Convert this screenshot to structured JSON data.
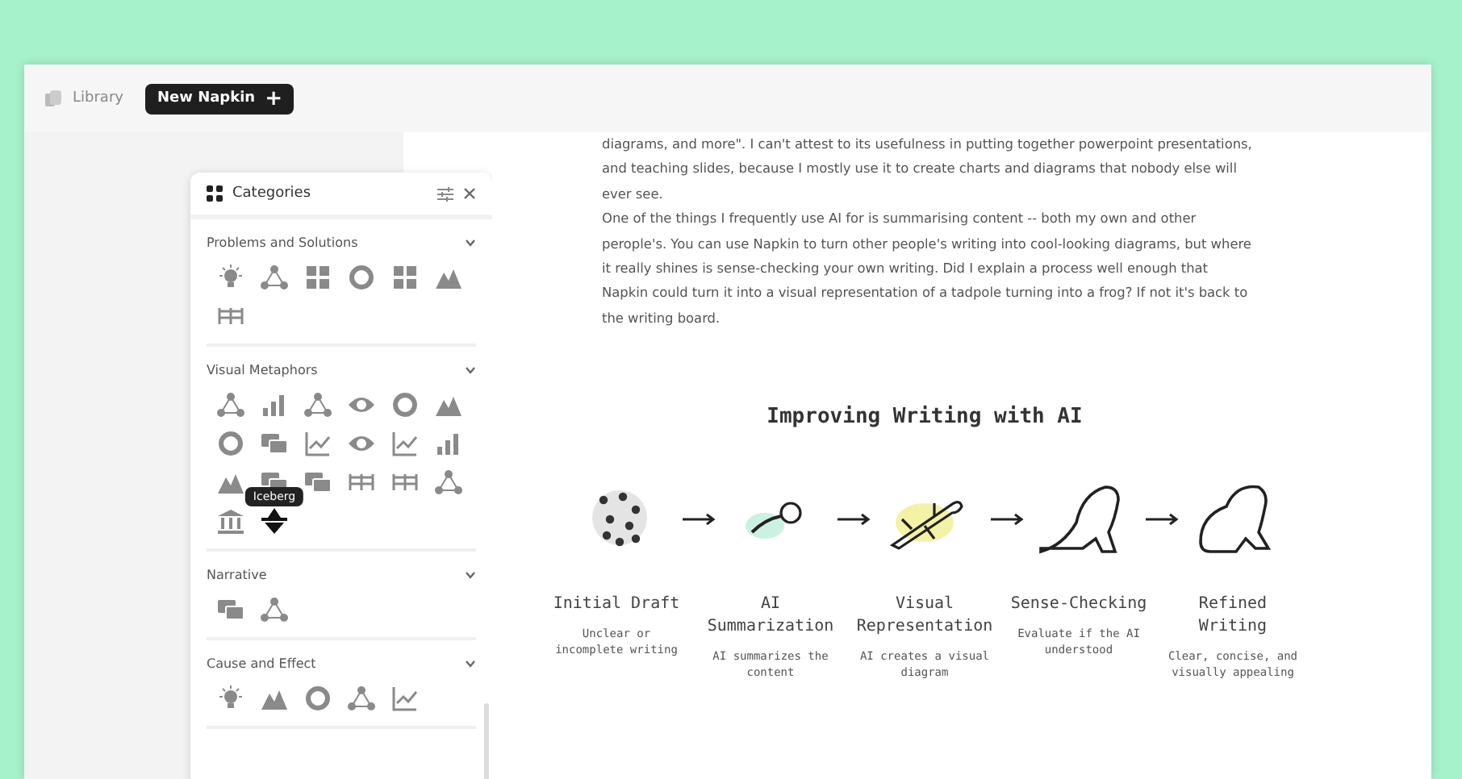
{
  "header": {
    "library": "Library",
    "new_button": "New Napkin",
    "new_button_icon": "+"
  },
  "categories_panel": {
    "title": "Categories",
    "sections": [
      {
        "name": "Problems and Solutions",
        "expanded": true
      },
      {
        "name": "Visual Metaphors",
        "expanded": true,
        "tooltip": "Iceberg"
      },
      {
        "name": "Narrative",
        "expanded": true
      },
      {
        "name": "Cause and Effect",
        "expanded": true
      }
    ]
  },
  "article": {
    "paragraphs": [
      "diagrams, and more\". I can't attest to its usefulness in putting together powerpoint presentations, and teaching slides, because I mostly use it to create charts and diagrams that nobody else will ever see.",
      "One of the things I frequently use AI for is summarising content -- both my own and other perople's. You can use Napkin to turn other people's writing into cool-looking diagrams, but where it really shines is sense-checking your own writing. Did I explain a process well enough that Napkin could turn it into a visual representation of a tadpole turning into a frog? If not it's back to the writing board."
    ]
  },
  "diagram": {
    "title": "Improving Writing with AI",
    "steps": [
      {
        "title": "Initial Draft",
        "caption": "Unclear or incomplete writing"
      },
      {
        "title": "AI Summarization",
        "caption": "AI summarizes the content"
      },
      {
        "title": "Visual Representation",
        "caption": "AI creates a visual diagram"
      },
      {
        "title": "Sense-Checking",
        "caption": "Evaluate if the AI understood"
      },
      {
        "title": "Refined Writing",
        "caption": "Clear, concise, and visually appealing"
      }
    ]
  }
}
